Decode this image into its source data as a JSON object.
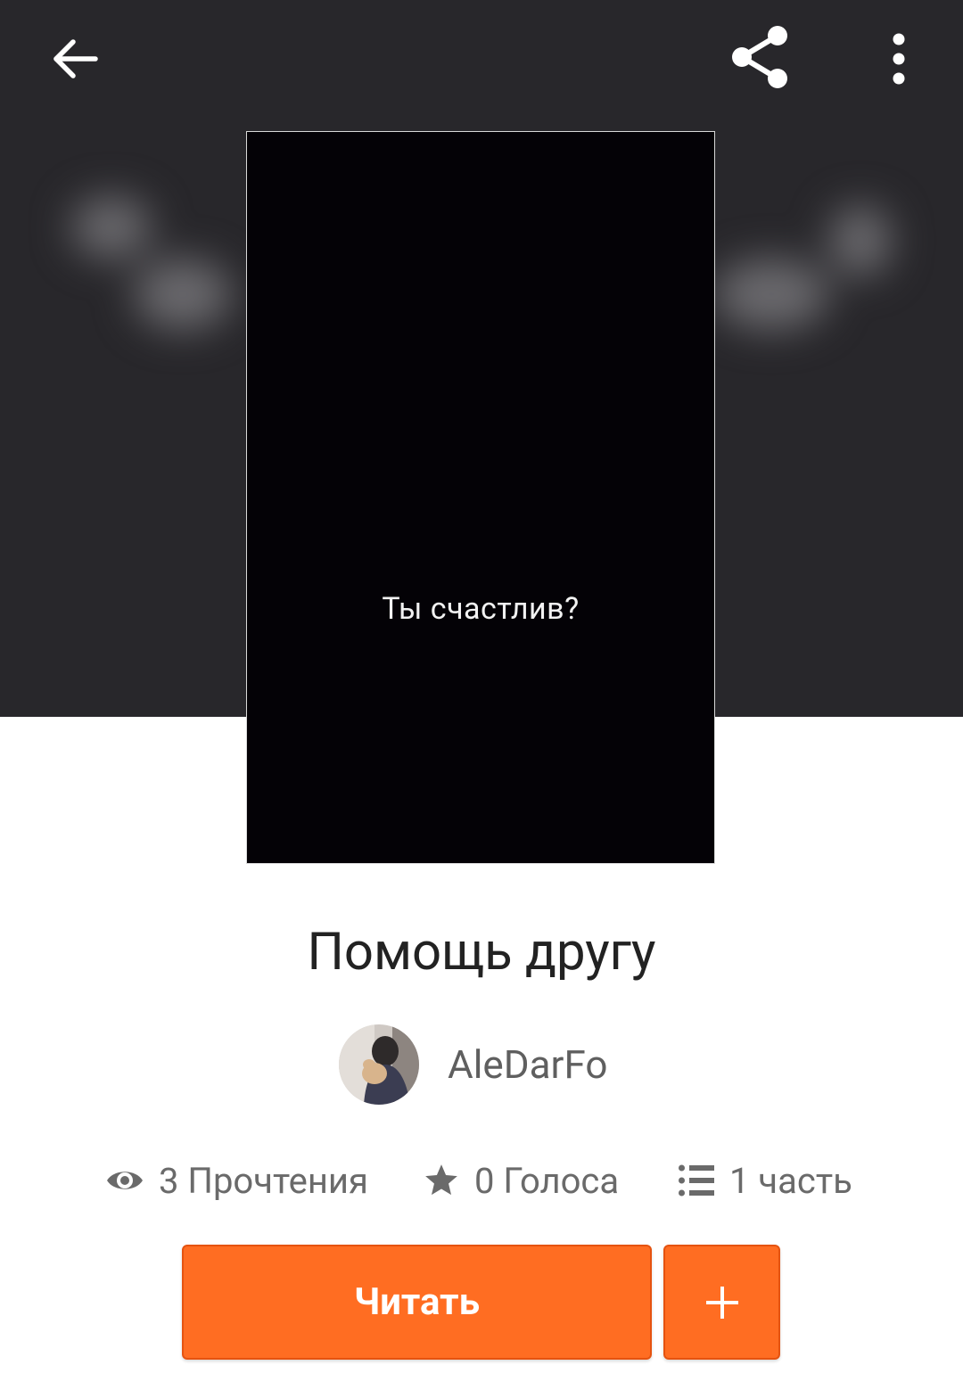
{
  "toolbar": {
    "back_icon": "arrow-back-icon",
    "share_icon": "share-icon",
    "more_icon": "more-vertical-icon"
  },
  "cover": {
    "text": "Ты счастлив?"
  },
  "story": {
    "title": "Помощь другу"
  },
  "author": {
    "name": "AleDarFo"
  },
  "stats": {
    "reads": "3 Прочтения",
    "votes": "0 Голоса",
    "parts": "1 часть"
  },
  "actions": {
    "read_label": "Читать",
    "add_icon": "plus-icon"
  },
  "colors": {
    "header_bg": "#28272b",
    "accent": "#ff6d22",
    "cover_bg": "#040206"
  }
}
